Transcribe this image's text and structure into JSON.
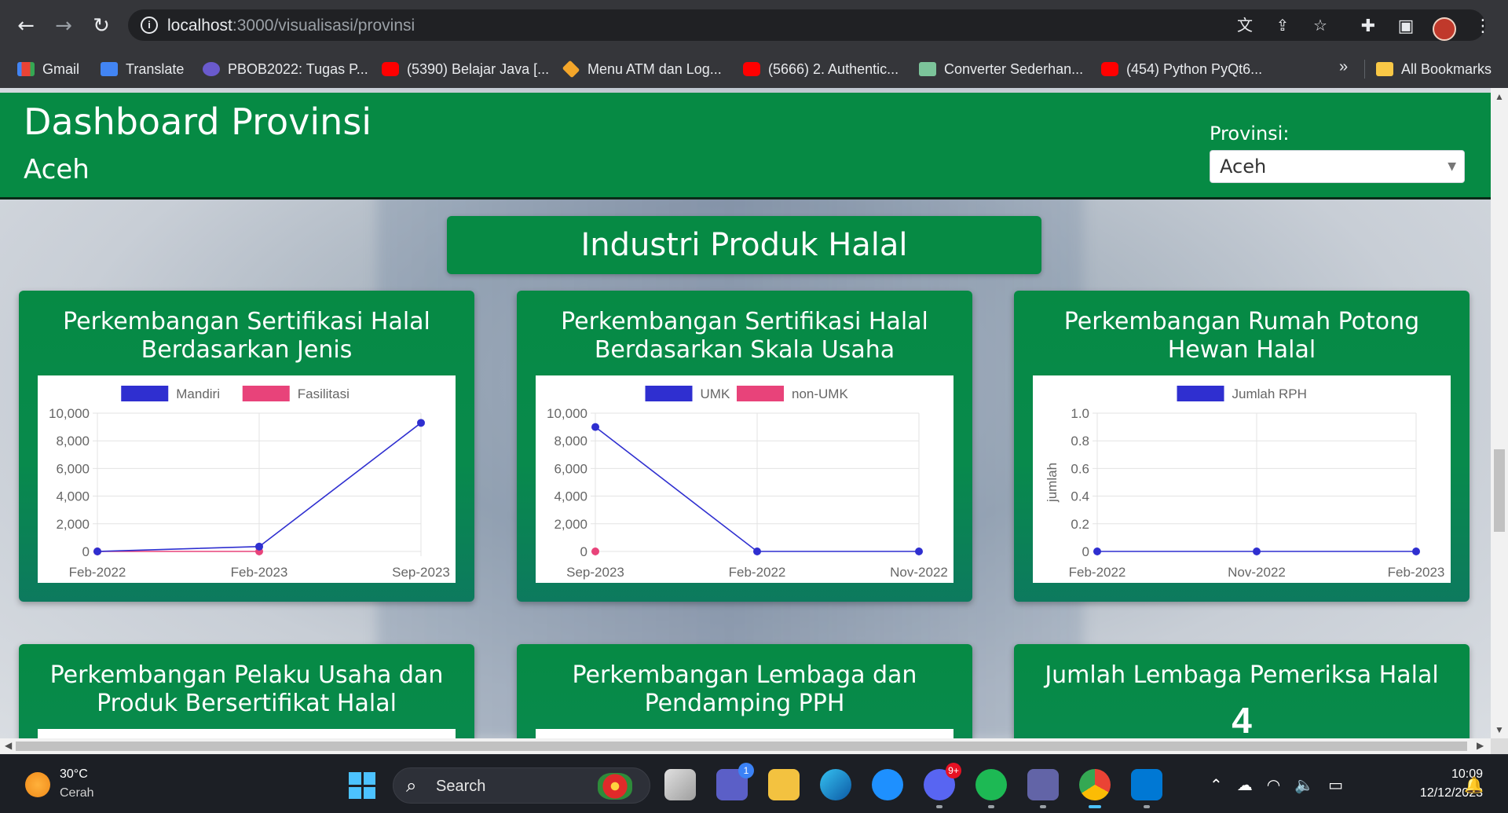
{
  "browser": {
    "url_host": "localhost",
    "url_path": ":3000/visualisasi/provinsi"
  },
  "bookmarks": [
    {
      "label": "Gmail",
      "icon": "gmail-icon"
    },
    {
      "label": "Translate",
      "icon": "translate-icon"
    },
    {
      "label": "PBOB2022: Tugas P...",
      "icon": "pbob-icon"
    },
    {
      "label": "(5390) Belajar Java [...",
      "icon": "youtube-icon"
    },
    {
      "label": "Menu ATM dan Log...",
      "icon": "box-icon"
    },
    {
      "label": "(5666) 2. Authentic...",
      "icon": "youtube-icon"
    },
    {
      "label": "Converter Sederhan...",
      "icon": "cube-icon"
    },
    {
      "label": "(454) Python PyQt6...",
      "icon": "youtube-icon"
    }
  ],
  "bookmarks_more": "»",
  "all_bookmarks": "All Bookmarks",
  "header": {
    "title": "Dashboard Provinsi",
    "subtitle": "Aceh",
    "province_label": "Provinsi:",
    "province_value": "Aceh"
  },
  "section_title": "Industri Produk Halal",
  "cards": [
    {
      "title": "Perkembangan Sertifikasi Halal Berdasarkan Jenis"
    },
    {
      "title": "Perkembangan Sertifikasi Halal Berdasarkan Skala Usaha"
    },
    {
      "title": "Perkembangan Rumah Potong Hewan Halal"
    },
    {
      "title": "Perkembangan Pelaku Usaha dan Produk Bersertifikat Halal"
    },
    {
      "title": "Perkembangan Lembaga dan Pendamping PPH"
    },
    {
      "title": "Jumlah Lembaga Pemeriksa Halal",
      "value": "4"
    }
  ],
  "colors": {
    "header_green": "#068a44",
    "series_blue": "#2f2fd0",
    "series_pink": "#e8437a"
  },
  "chart_data": [
    {
      "type": "line",
      "categories": [
        "Feb-2022",
        "Feb-2023",
        "Sep-2023"
      ],
      "series": [
        {
          "name": "Mandiri",
          "values": [
            0,
            350,
            9300
          ],
          "color": "#2f2fd0"
        },
        {
          "name": "Fasilitasi",
          "values": [
            0,
            0,
            null
          ],
          "color": "#e8437a"
        }
      ],
      "ylim": [
        0,
        10000
      ],
      "yticks": [
        "10,000",
        "8,000",
        "6,000",
        "4,000",
        "2,000",
        "0"
      ],
      "ylabel": "",
      "legend": "top",
      "grid": true
    },
    {
      "type": "line",
      "categories": [
        "Sep-2023",
        "Feb-2022",
        "Nov-2022"
      ],
      "series": [
        {
          "name": "UMK",
          "values": [
            9000,
            0,
            0
          ],
          "color": "#2f2fd0"
        },
        {
          "name": "non-UMK",
          "values": [
            0,
            null,
            null
          ],
          "color": "#e8437a"
        }
      ],
      "ylim": [
        0,
        10000
      ],
      "yticks": [
        "10,000",
        "8,000",
        "6,000",
        "4,000",
        "2,000",
        "0"
      ],
      "ylabel": "",
      "legend": "top",
      "grid": true
    },
    {
      "type": "line",
      "categories": [
        "Feb-2022",
        "Nov-2022",
        "Feb-2023"
      ],
      "series": [
        {
          "name": "Jumlah RPH",
          "values": [
            0,
            0,
            0
          ],
          "color": "#2f2fd0"
        }
      ],
      "ylim": [
        0,
        1
      ],
      "yticks": [
        "1.0",
        "0.8",
        "0.6",
        "0.4",
        "0.2",
        "0"
      ],
      "ylabel": "jumlah",
      "legend": "top",
      "grid": true
    }
  ],
  "taskbar": {
    "weather_temp": "30°C",
    "weather_desc": "Cerah",
    "search_label": "Search",
    "teams_badge": "1",
    "discord_badge": "9+",
    "clock_time": "10:09",
    "clock_date": "12/12/2023"
  }
}
